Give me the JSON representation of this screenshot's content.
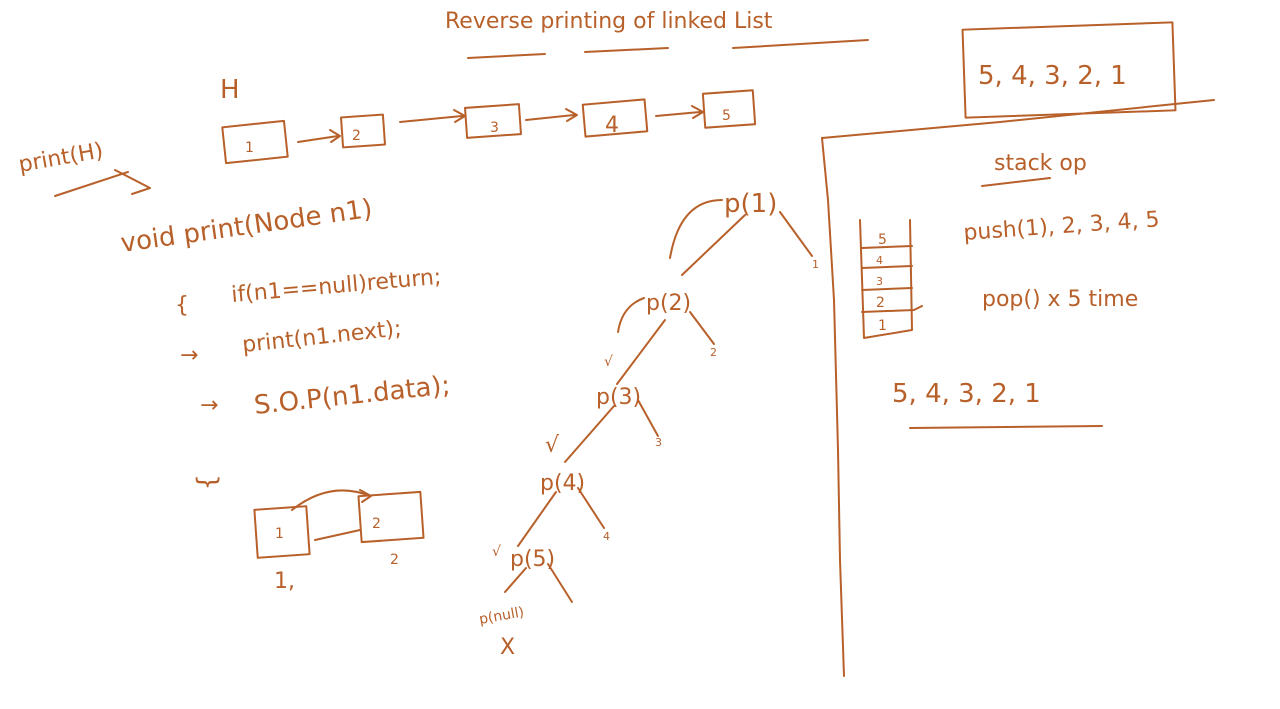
{
  "title": "Reverse printing of linked List",
  "head_label": "H",
  "call_label": "print(H)",
  "list_nodes": [
    "1",
    "2",
    "3",
    "4",
    "5"
  ],
  "code": {
    "signature": "void print(Node n1)",
    "open_brace": "{",
    "line1": "if(n1==null)return;",
    "line2_arrow": "→",
    "line2": "print(n1.next);",
    "line3_arrow": "→",
    "line3": "S.O.P(n1.data);",
    "close_brace": "}"
  },
  "mini_list": {
    "nodes": [
      "1",
      "2"
    ],
    "under_1": "1,",
    "under_2": "2"
  },
  "recursion": {
    "calls": [
      "p(1)",
      "p(2)",
      "p(3)",
      "p(4)",
      "p(5)",
      "p(null)"
    ],
    "printed": [
      "1",
      "2",
      "3",
      "4"
    ],
    "tick": "√",
    "cross": "X"
  },
  "output_box": "5, 4, 3, 2, 1",
  "stack": {
    "heading": "stack op",
    "cells": [
      "5",
      "4",
      "3",
      "2",
      "1"
    ],
    "push_note": "push(1), 2, 3, 4, 5",
    "pop_note": "pop() x 5 time",
    "result": "5, 4, 3, 2, 1"
  }
}
